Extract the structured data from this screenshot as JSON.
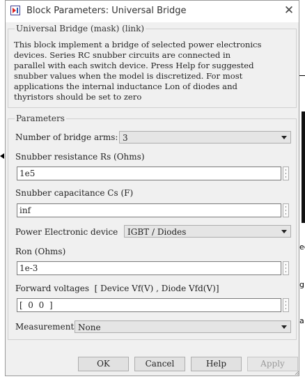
{
  "window": {
    "title": "Block Parameters: Universal Bridge",
    "close_icon": "close-icon",
    "app_icon": "simulink-block-icon"
  },
  "mask": {
    "group_title": "Universal Bridge (mask) (link)",
    "description": "This block implement a bridge of selected power electronics\ndevices.  Series RC snubber circuits are connected in\nparallel with each switch device.  Press Help for suggested\nsnubber values when the model is discretized. For most\napplications the internal inductance Lon of diodes and\nthyristors should be set to zero"
  },
  "parameters": {
    "group_title": "Parameters",
    "bridge_arms": {
      "label": "Number of bridge arms:",
      "value": "3"
    },
    "snubber_rs": {
      "label": "Snubber resistance Rs (Ohms)",
      "value": "1e5"
    },
    "snubber_cs": {
      "label": "Snubber capacitance Cs (F)",
      "value": "inf"
    },
    "device": {
      "label": "Power Electronic device",
      "value": "IGBT / Diodes"
    },
    "ron": {
      "label": "Ron (Ohms)",
      "value": "1e-3"
    },
    "forward_voltages": {
      "label": "Forward voltages  [ Device Vf(V) , Diode Vfd(V)]",
      "value": "[  0  0  ]"
    },
    "measurements": {
      "label": "Measurements",
      "value": "None"
    }
  },
  "buttons": {
    "ok": "OK",
    "cancel": "Cancel",
    "help": "Help",
    "apply": "Apply"
  },
  "background": {
    "fragments": [
      "ee",
      "gl",
      "a"
    ]
  }
}
